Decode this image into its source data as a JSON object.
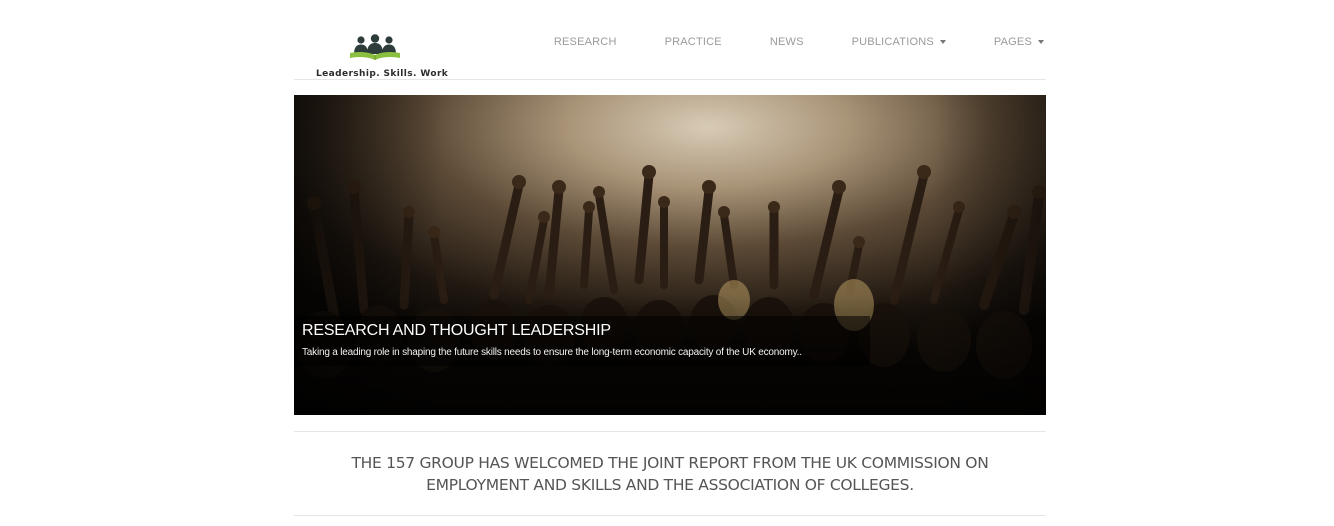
{
  "logo": {
    "tagline": "Leadership. Skills. Work",
    "icon": "people-on-book-logo-icon",
    "colors": {
      "figures": "#2e3b3b",
      "book": "#8bbf3f"
    }
  },
  "nav": {
    "items": [
      {
        "label": "RESEARCH",
        "dropdown": false
      },
      {
        "label": "PRACTICE",
        "dropdown": false
      },
      {
        "label": "NEWS",
        "dropdown": false
      },
      {
        "label": "PUBLICATIONS",
        "dropdown": true
      },
      {
        "label": "PAGES",
        "dropdown": true
      }
    ]
  },
  "hero": {
    "title": "RESEARCH AND THOUGHT LEADERSHIP",
    "text": "Taking a leading role in shaping the future skills needs to ensure the long-term economic capacity of the UK economy..",
    "image": "concert-crowd-raised-hands-photo"
  },
  "announcement": {
    "line1": "THE 157 GROUP HAS WELCOMED THE JOINT REPORT FROM THE UK COMMISSION ON",
    "line2": "EMPLOYMENT AND SKILLS AND THE ASSOCIATION OF COLLEGES."
  }
}
